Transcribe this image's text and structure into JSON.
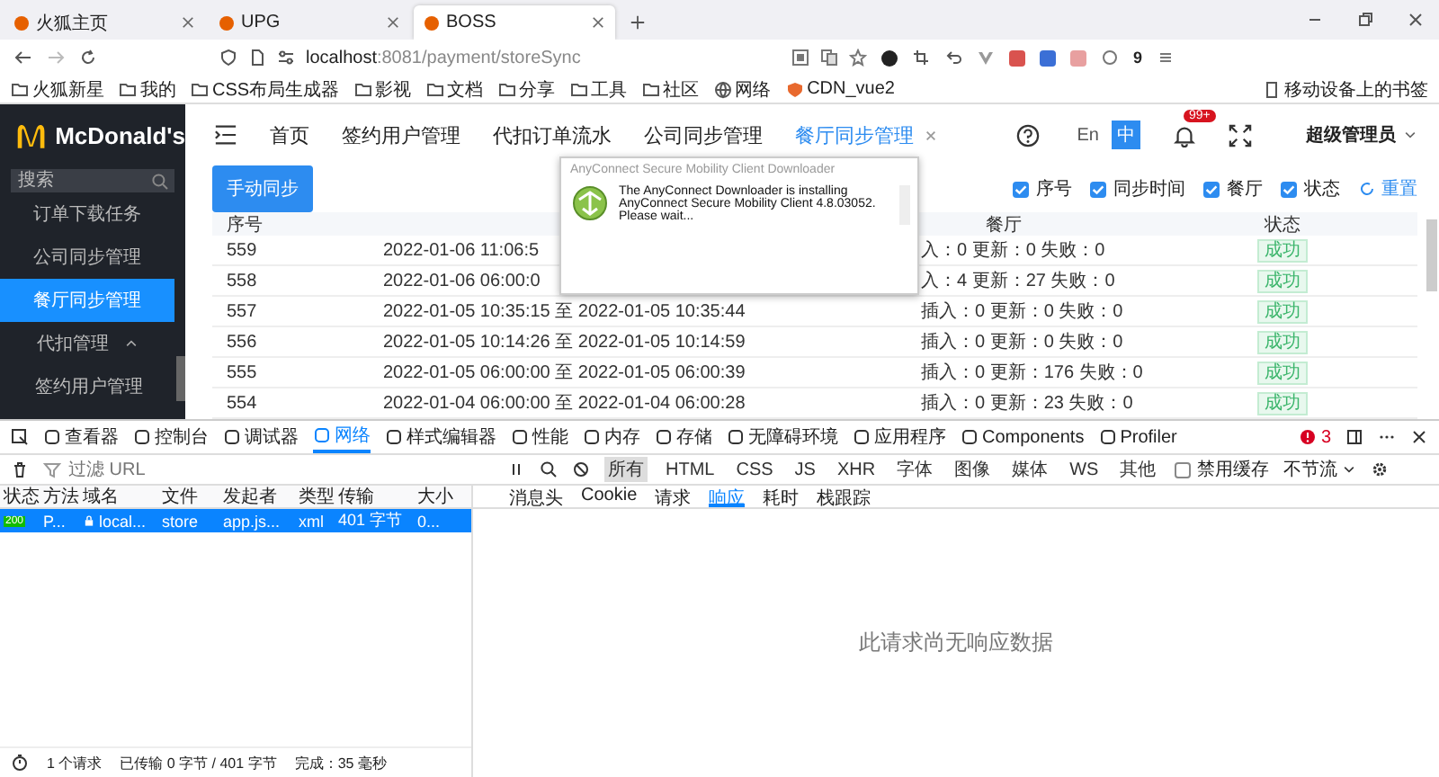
{
  "browser": {
    "tabs": [
      {
        "title": "火狐主页",
        "selected": false
      },
      {
        "title": "UPG",
        "selected": false
      },
      {
        "title": "BOSS",
        "selected": true
      }
    ],
    "address": {
      "host": "localhost",
      "path": ":8081/payment/storeSync"
    },
    "extension_badge": "9",
    "bookmarks": [
      {
        "label": "火狐新星",
        "kind": "folder"
      },
      {
        "label": "我的",
        "kind": "folder"
      },
      {
        "label": "CSS布局生成器",
        "kind": "folder"
      },
      {
        "label": "影视",
        "kind": "folder"
      },
      {
        "label": "文档",
        "kind": "folder"
      },
      {
        "label": "分享",
        "kind": "folder"
      },
      {
        "label": "工具",
        "kind": "folder"
      },
      {
        "label": "社区",
        "kind": "folder"
      },
      {
        "label": "网络",
        "kind": "web"
      },
      {
        "label": "CDN_vue2",
        "kind": "shield"
      }
    ],
    "mobile_bookmarks": "移动设备上的书签"
  },
  "app": {
    "logo": "McDonald's",
    "search": {
      "placeholder": "搜索"
    },
    "sidebar": [
      {
        "label": "订单下载任务",
        "selected": false
      },
      {
        "label": "公司同步管理",
        "selected": false
      },
      {
        "label": "餐厅同步管理",
        "selected": true
      },
      {
        "label": "代扣管理",
        "selected": false,
        "expanded": true,
        "children": [
          {
            "label": "签约用户管理",
            "selected": false
          }
        ]
      }
    ],
    "nav_tabs": [
      {
        "label": "首页",
        "selected": false
      },
      {
        "label": "签约用户管理",
        "selected": false
      },
      {
        "label": "代扣订单流水",
        "selected": false
      },
      {
        "label": "公司同步管理",
        "selected": false
      },
      {
        "label": "餐厅同步管理",
        "selected": true
      }
    ],
    "languages": [
      {
        "label": "En",
        "selected": false
      },
      {
        "label": "中",
        "selected": true
      }
    ],
    "notification_badge": "99+",
    "user": "超级管理员",
    "sync_button": "手动同步",
    "column_toggles": [
      {
        "label": "序号",
        "checked": true
      },
      {
        "label": "同步时间",
        "checked": true
      },
      {
        "label": "餐厅",
        "checked": true
      },
      {
        "label": "状态",
        "checked": true
      }
    ],
    "reset": "重置",
    "table": {
      "headers": [
        "序号",
        "餐厅",
        "状态"
      ],
      "rows": [
        {
          "id": "559",
          "time": "2022-01-06 11:06:5",
          "counts": "入：0 更新：0 失败：0",
          "status": "成功"
        },
        {
          "id": "558",
          "time": "2022-01-06 06:00:0",
          "counts": "入：4 更新：27 失败：0",
          "status": "成功"
        },
        {
          "id": "557",
          "time": "2022-01-05 10:35:15 至 2022-01-05 10:35:44",
          "counts": "插入：0 更新：0 失败：0",
          "status": "成功"
        },
        {
          "id": "556",
          "time": "2022-01-05 10:14:26 至 2022-01-05 10:14:59",
          "counts": "插入：0 更新：0 失败：0",
          "status": "成功"
        },
        {
          "id": "555",
          "time": "2022-01-05 06:00:00 至 2022-01-05 06:00:39",
          "counts": "插入：0 更新：176 失败：0",
          "status": "成功"
        },
        {
          "id": "554",
          "time": "2022-01-04 06:00:00 至 2022-01-04 06:00:28",
          "counts": "插入：0 更新：23 失败：0",
          "status": "成功"
        }
      ]
    },
    "popup": {
      "title": "AnyConnect Secure Mobility Client Downloader",
      "message": "The AnyConnect Downloader is installing AnyConnect Secure Mobility Client 4.8.03052. Please wait..."
    }
  },
  "devtools": {
    "tools": [
      {
        "label": "查看器",
        "selected": false
      },
      {
        "label": "控制台",
        "selected": false
      },
      {
        "label": "调试器",
        "selected": false
      },
      {
        "label": "网络",
        "selected": true
      },
      {
        "label": "样式编辑器",
        "selected": false
      },
      {
        "label": "性能",
        "selected": false
      },
      {
        "label": "内存",
        "selected": false
      },
      {
        "label": "存储",
        "selected": false
      },
      {
        "label": "无障碍环境",
        "selected": false
      },
      {
        "label": "应用程序",
        "selected": false
      },
      {
        "label": "Components",
        "selected": false
      },
      {
        "label": "Profiler",
        "selected": false
      }
    ],
    "error_count": "3",
    "filter": {
      "placeholder": "过滤 URL"
    },
    "types": [
      {
        "label": "所有",
        "selected": true
      },
      {
        "label": "HTML",
        "selected": false
      },
      {
        "label": "CSS",
        "selected": false
      },
      {
        "label": "JS",
        "selected": false
      },
      {
        "label": "XHR",
        "selected": false
      },
      {
        "label": "字体",
        "selected": false
      },
      {
        "label": "图像",
        "selected": false
      },
      {
        "label": "媒体",
        "selected": false
      },
      {
        "label": "WS",
        "selected": false
      },
      {
        "label": "其他",
        "selected": false
      }
    ],
    "disable_cache": {
      "label": "禁用缓存",
      "checked": false
    },
    "throttle": "不节流",
    "columns": [
      "状态",
      "方法",
      "域名",
      "文件",
      "发起者",
      "类型",
      "传输",
      "大小"
    ],
    "requests": [
      {
        "status": "200",
        "method": "P...",
        "domain": "local...",
        "file": "store",
        "initiator": "app.js...",
        "type": "xml",
        "transferred": "401 字节",
        "size": "0...",
        "selected": true
      }
    ],
    "detail_tabs": [
      {
        "label": "消息头",
        "selected": false
      },
      {
        "label": "Cookie",
        "selected": false
      },
      {
        "label": "请求",
        "selected": false
      },
      {
        "label": "响应",
        "selected": true
      },
      {
        "label": "耗时",
        "selected": false
      },
      {
        "label": "栈跟踪",
        "selected": false
      }
    ],
    "empty_message": "此请求尚无响应数据",
    "footer": [
      "1 个请求",
      "已传输 0 字节 / 401 字节",
      "完成：35 毫秒"
    ]
  }
}
